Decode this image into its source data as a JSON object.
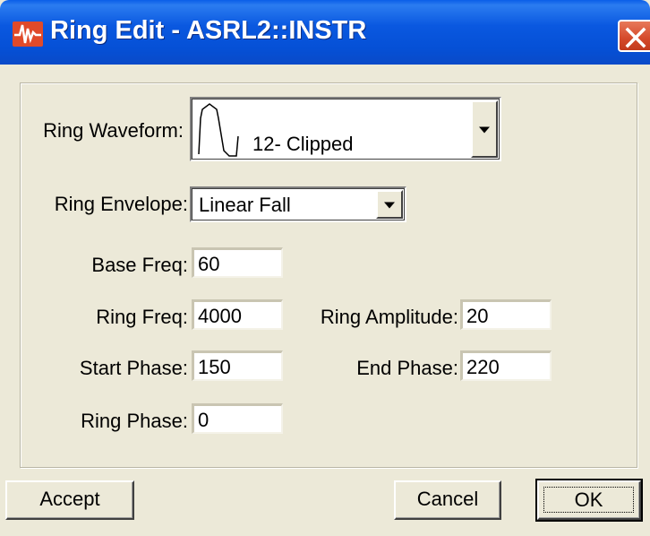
{
  "window": {
    "title": "Ring Edit - ASRL2::INSTR"
  },
  "form": {
    "ring_waveform": {
      "label": "Ring Waveform:",
      "value": "12- Clipped"
    },
    "ring_envelope": {
      "label": "Ring Envelope:",
      "value": "Linear Fall"
    },
    "base_freq": {
      "label": "Base Freq:",
      "value": "60"
    },
    "ring_freq": {
      "label": "Ring Freq:",
      "value": "4000"
    },
    "ring_amplitude": {
      "label": "Ring Amplitude:",
      "value": "20"
    },
    "start_phase": {
      "label": "Start Phase:",
      "value": "150"
    },
    "end_phase": {
      "label": "End Phase:",
      "value": "220"
    },
    "ring_phase": {
      "label": "Ring Phase:",
      "value": "0"
    }
  },
  "buttons": {
    "accept": "Accept",
    "cancel": "Cancel",
    "ok": "OK"
  },
  "icons": {
    "app": "waveform-icon",
    "close": "close-icon",
    "waveform_preview": "clipped-waveform-icon",
    "dropdown": "dropdown-arrow-icon"
  },
  "colors": {
    "titlebar": "#0a58e0",
    "close_button": "#d4492a",
    "dialog_bg": "#ece9d8",
    "field_bg": "#ffffff"
  }
}
